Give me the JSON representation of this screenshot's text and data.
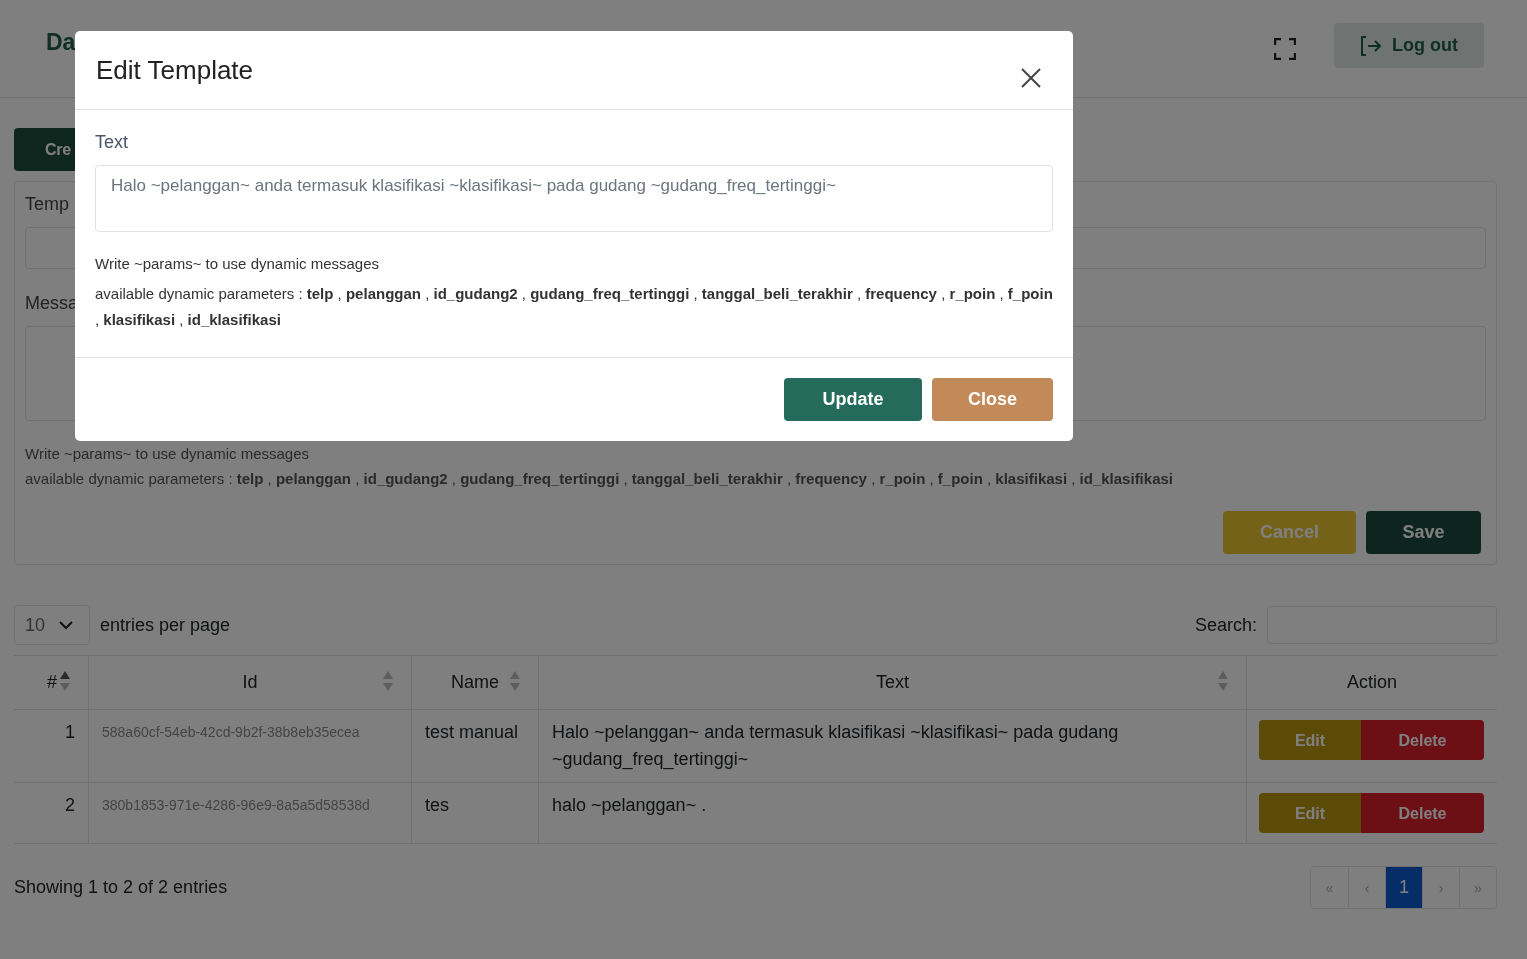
{
  "header": {
    "brand": "Da",
    "logout": "Log out"
  },
  "create_button": "Cre",
  "form": {
    "template_label": "Temp",
    "message_label": "Messa",
    "help": "Write ~params~ to use dynamic messages",
    "params_line": "available dynamic parameters : **telp** , **pelanggan** , **id_gudang2** , **gudang_freq_tertinggi** , **tanggal_beli_terakhir** , **frequency** , **r_poin** , **f_poin** , **klasifikasi** , **id_klasifikasi**",
    "cancel": "Cancel",
    "save": "Save"
  },
  "table_controls": {
    "page_size": "10",
    "entries_label": "entries per page",
    "search_label": "Search:"
  },
  "table": {
    "columns": [
      {
        "label": "#",
        "sorted_ascending": true
      },
      {
        "label": "Id",
        "sorted_ascending": false
      },
      {
        "label": "Name",
        "sorted_ascending": false
      },
      {
        "label": "Text",
        "sorted_ascending": false
      },
      {
        "label": "Action"
      }
    ],
    "rows": [
      {
        "index": "1",
        "id": "588a60cf-54eb-42cd-9b2f-38b8eb35ecea",
        "name": "test manual",
        "text": "Halo ~pelanggan~ anda termasuk klasifikasi ~klasifikasi~ pada gudang ~gudang_freq_tertinggi~",
        "edit": "Edit",
        "delete": "Delete"
      },
      {
        "index": "2",
        "id": "380b1853-971e-4286-96e9-8a5a5d58538d",
        "name": "tes",
        "text": "halo ~pelanggan~ .",
        "edit": "Edit",
        "delete": "Delete"
      }
    ]
  },
  "footer": {
    "showing": "Showing 1 to 2 of 2 entries",
    "pages": [
      {
        "label": "«",
        "selected": false
      },
      {
        "label": "‹",
        "selected": false
      },
      {
        "label": "1",
        "selected": true
      },
      {
        "label": "›",
        "selected": false
      },
      {
        "label": "»",
        "selected": false
      }
    ]
  },
  "modal": {
    "title": "Edit Template",
    "field_label": "Text",
    "field_value": "Halo ~pelanggan~ anda termasuk klasifikasi ~klasifikasi~ pada gudang ~gudang_freq_tertinggi~",
    "help": "Write ~params~ to use dynamic messages",
    "params_line": "available dynamic parameters : **telp** , **pelanggan** , **id_gudang2** , **gudang_freq_tertinggi** , **tanggal_beli_terakhir** , **frequency** , **r_poin** , **f_poin** , **klasifikasi** , **id_klasifikasi**",
    "update": "Update",
    "close": "Close"
  }
}
